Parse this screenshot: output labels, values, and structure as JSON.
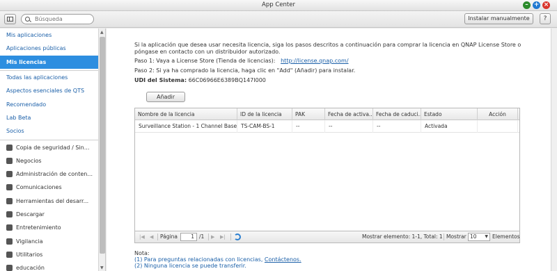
{
  "window": {
    "title": "App Center"
  },
  "toolbar": {
    "search_placeholder": "Búsqueda",
    "install_manually": "Instalar manualmente",
    "help": "?"
  },
  "sidebar": {
    "items": [
      {
        "label": "Mis aplicaciones"
      },
      {
        "label": "Aplicaciones públicas"
      },
      {
        "label": "Mis licencias"
      },
      {
        "label": "Todas las aplicaciones"
      },
      {
        "label": "Aspectos esenciales de QTS"
      },
      {
        "label": "Recomendado"
      },
      {
        "label": "Lab Beta"
      },
      {
        "label": "Socios"
      }
    ],
    "categories": [
      {
        "label": "Copia de seguridad / Sin...",
        "icon": "backup-icon"
      },
      {
        "label": "Negocios",
        "icon": "business-icon"
      },
      {
        "label": "Administración de conten...",
        "icon": "content-management-icon"
      },
      {
        "label": "Comunicaciones",
        "icon": "communications-icon"
      },
      {
        "label": "Herramientas del desarr...",
        "icon": "tools-icon"
      },
      {
        "label": "Descargar",
        "icon": "download-icon"
      },
      {
        "label": "Entretenimiento",
        "icon": "entertainment-icon"
      },
      {
        "label": "Vigilancia",
        "icon": "surveillance-icon"
      },
      {
        "label": "Utilitarios",
        "icon": "utilities-icon"
      },
      {
        "label": "educación",
        "icon": "education-icon"
      }
    ]
  },
  "main": {
    "intro_line1": "Si la aplicación que desea usar necesita licencia, siga los pasos descritos a continuación para comprar la licencia en QNAP License Store o",
    "intro_line2": "póngase en contacto con un distribuidor autorizado.",
    "step1_text": "Paso 1: Vaya a License Store (Tienda de licencias):",
    "step1_link": "http://license.qnap.com/",
    "step2_text": "Paso 2: Si ya ha comprado la licencia, haga clic en \"Add\" (Añadir) para instalar.",
    "udi_label": "UDI del Sistema:",
    "udi_value": "66C06966E6389BQ147I000",
    "add_button": "Añadir"
  },
  "table": {
    "columns": [
      "Nombre de la licencia",
      "ID de la licencia",
      "PAK",
      "Fecha de activa...",
      "Fecha de caduci...",
      "Estado",
      "Acción"
    ],
    "rows": [
      {
        "name": "Surveillance Station - 1 Channel Base...",
        "id": "TS-CAM-BS-1",
        "pak": "--",
        "activation": "--",
        "expiry": "--",
        "status": "Activada",
        "action": ""
      }
    ]
  },
  "pager": {
    "page_label": "Página",
    "page_value": "1",
    "page_total": "/1",
    "display_info": "Mostrar elemento: 1-1, Total: 1",
    "show_label": "Mostrar",
    "page_size": "10",
    "items_label": "Elementos"
  },
  "notes": {
    "title": "Nota:",
    "line1_text": "(1) Para preguntas relacionadas con licencias,",
    "line1_link": "Contáctenos.",
    "line2": "(2) Ninguna licencia se puede transferir."
  }
}
